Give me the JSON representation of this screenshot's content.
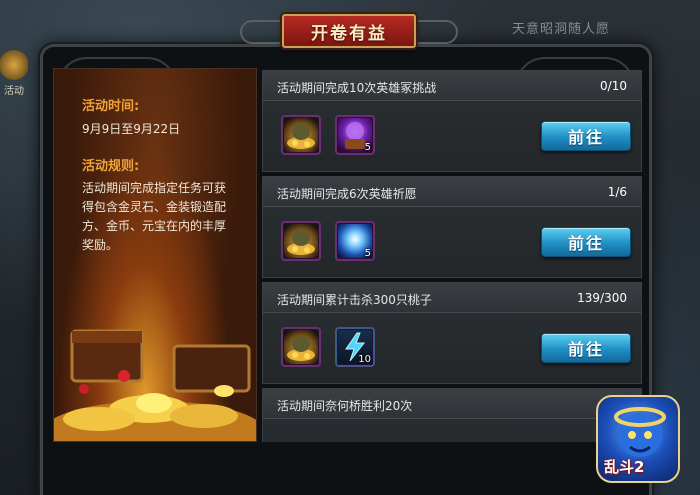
{
  "background": {
    "top_text": "天意昭洞随人愿",
    "side_label": "活动"
  },
  "title": "开卷有益",
  "info": {
    "time_heading": "活动时间:",
    "time_value": "9月9日至9月22日",
    "rules_heading": "活动规则:",
    "rules_lines": [
      "活动期间完成指定任务可获",
      "得包含金灵石、金装锻造配",
      "方、金币、元宝在内的丰厚",
      "奖励。"
    ]
  },
  "quests": [
    {
      "title": "活动期间完成10次英雄冢挑战",
      "progress": "0/10",
      "rewards": [
        {
          "icon": "gold-coin-sack-icon",
          "count": ""
        },
        {
          "icon": "purple-orb-chest-icon",
          "count": "5"
        }
      ],
      "button": "前往"
    },
    {
      "title": "活动期间完成6次英雄祈愿",
      "progress": "1/6",
      "rewards": [
        {
          "icon": "gold-coin-sack-icon",
          "count": ""
        },
        {
          "icon": "blue-magic-orb-icon",
          "count": "5"
        }
      ],
      "button": "前往"
    },
    {
      "title": "活动期间累计击杀300只桃子",
      "progress": "139/300",
      "rewards": [
        {
          "icon": "gold-coin-sack-icon",
          "count": ""
        },
        {
          "icon": "lightning-bolt-icon",
          "count": "10"
        }
      ],
      "button": "前往"
    },
    {
      "title": "活动期间奈何桥胜利20次",
      "progress": "",
      "rewards": [],
      "button": ""
    }
  ],
  "logo": {
    "text": "乱斗2"
  },
  "colors": {
    "accent_orange": "#f0a23a",
    "banner_red": "#b52a22",
    "button_blue": "#1f8fc4",
    "reward_border": "#6a2f70"
  }
}
